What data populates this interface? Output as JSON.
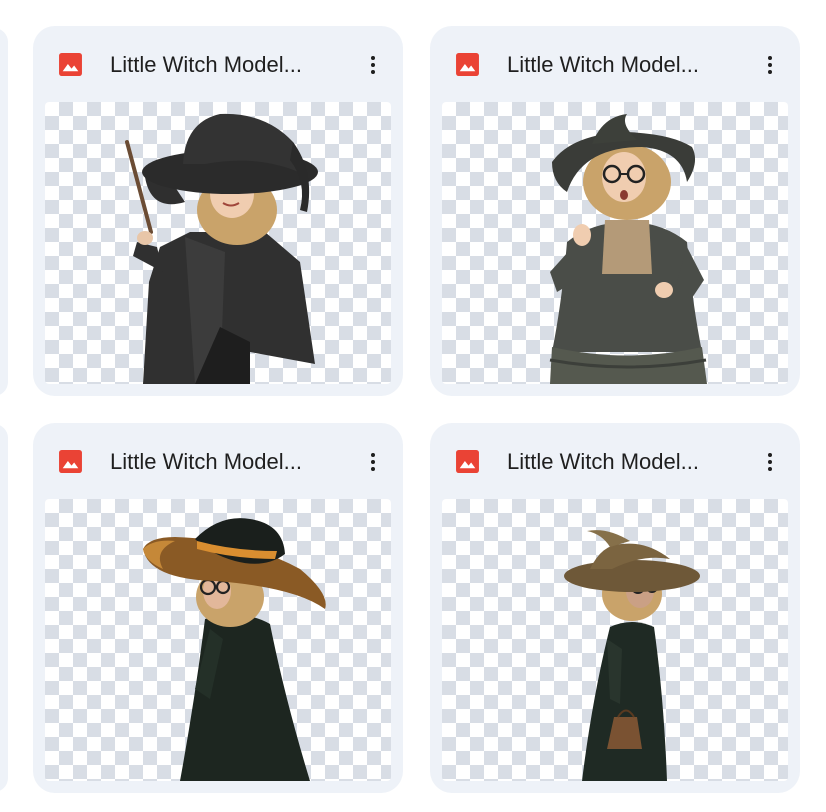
{
  "files": [
    {
      "name": "Little Witch Model...",
      "type_icon": "image-icon",
      "menu_icon": "more-vert-icon"
    },
    {
      "name": "Little Witch Model...",
      "type_icon": "image-icon",
      "menu_icon": "more-vert-icon"
    },
    {
      "name": "Little Witch Model...",
      "type_icon": "image-icon",
      "menu_icon": "more-vert-icon"
    },
    {
      "name": "Little Witch Model...",
      "type_icon": "image-icon",
      "menu_icon": "more-vert-icon"
    }
  ],
  "colors": {
    "card_background": "#eef2f8",
    "image_type_icon": "#ea4335",
    "transparency_checker": "#d8dde5"
  }
}
